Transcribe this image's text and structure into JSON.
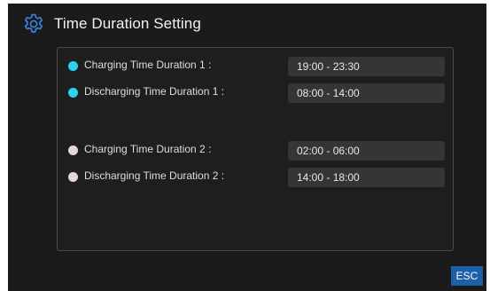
{
  "header": {
    "title": "Time Duration Setting",
    "icon": "gear-icon"
  },
  "colors": {
    "charging_group_1": "#2ad4ee",
    "charging_group_2": "#e3d7dc",
    "accent": "#1f5fa8",
    "icon_color": "#3a86e8"
  },
  "durations": [
    {
      "label": "Charging Time Duration 1 :",
      "value": "19:00 - 23:30"
    },
    {
      "label": "Discharging Time Duration 1 :",
      "value": "08:00 - 14:00"
    },
    {
      "label": "Charging Time Duration 2 :",
      "value": "02:00 - 06:00"
    },
    {
      "label": "Discharging Time Duration 2 :",
      "value": "14:00 - 18:00"
    }
  ],
  "esc_label": "ESC"
}
